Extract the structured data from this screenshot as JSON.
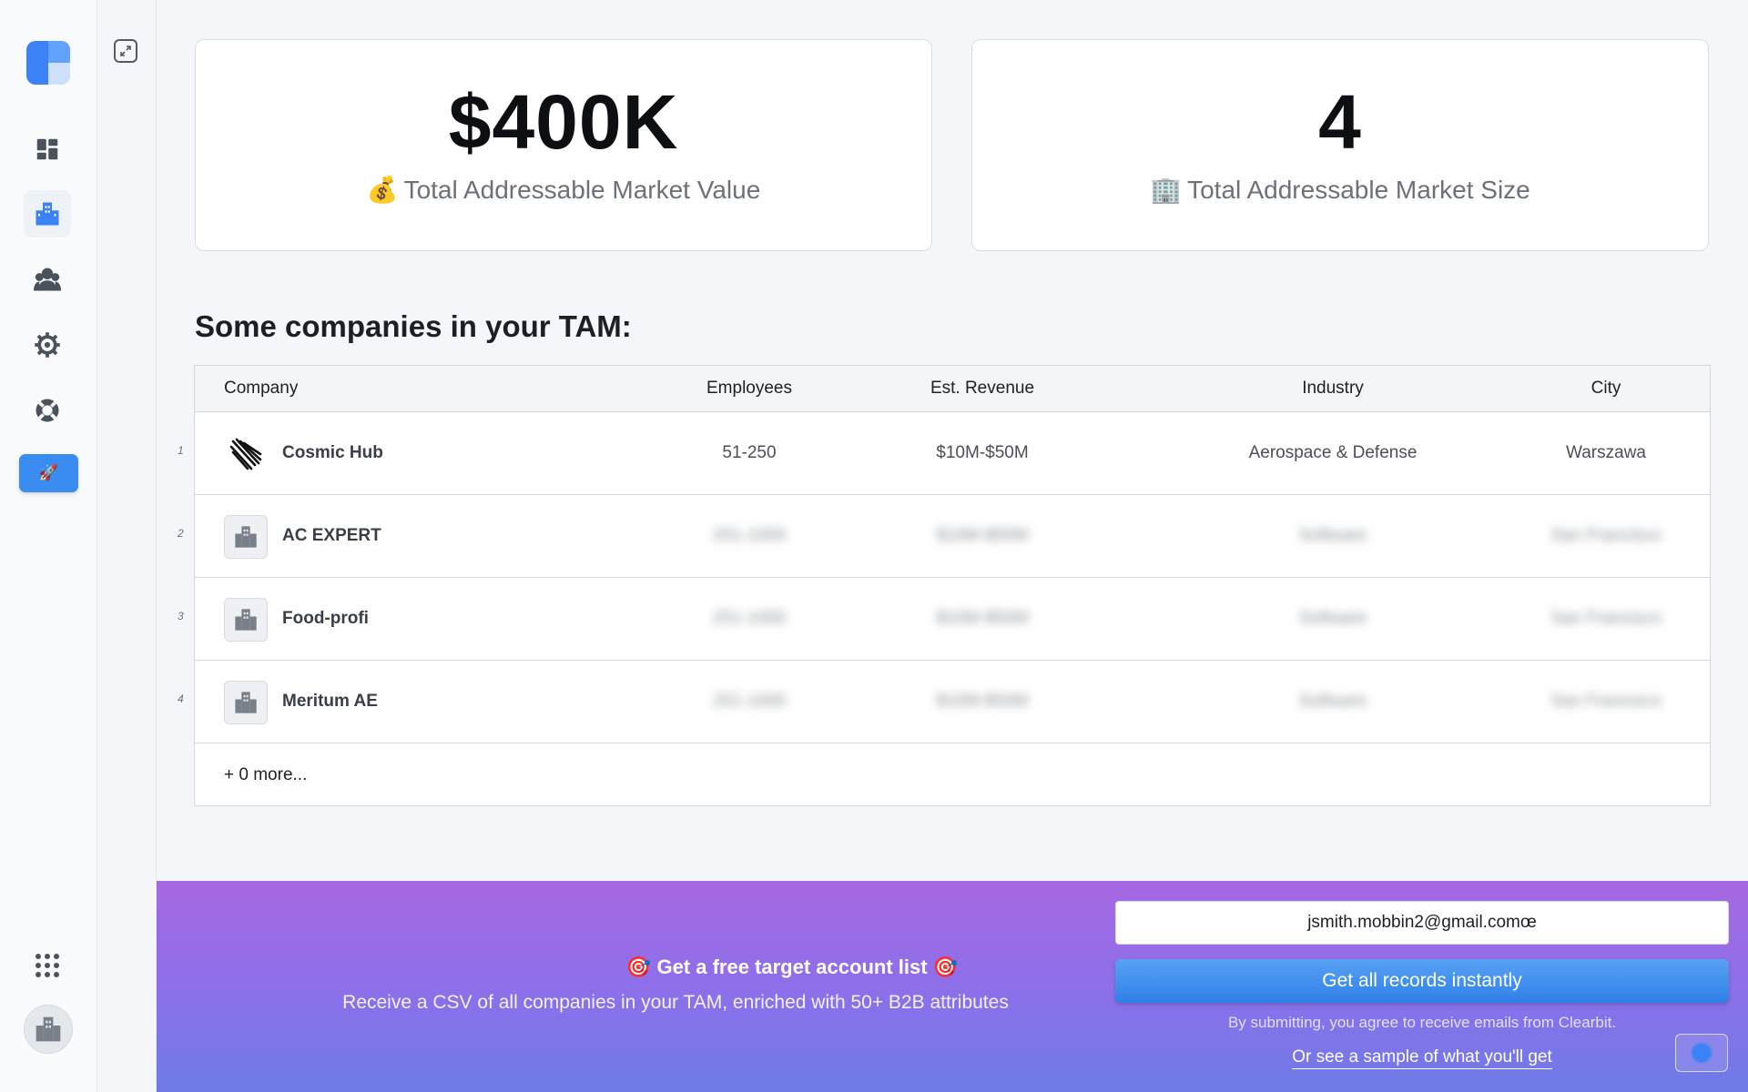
{
  "sidebar": {
    "items": [
      {
        "name": "dashboard",
        "icon": "dashboard-icon"
      },
      {
        "name": "companies",
        "icon": "buildings-icon",
        "active": true
      },
      {
        "name": "people",
        "icon": "people-icon"
      },
      {
        "name": "settings",
        "icon": "gear-icon"
      },
      {
        "name": "support",
        "icon": "lifebuoy-icon"
      },
      {
        "name": "launch",
        "icon": "rocket-icon"
      }
    ]
  },
  "stats": {
    "value": {
      "number": "$400K",
      "emoji": "💰",
      "label": "Total Addressable Market Value"
    },
    "size": {
      "number": "4",
      "emoji": "🏢",
      "label": "Total Addressable Market Size"
    }
  },
  "section_title": "Some companies in your TAM:",
  "table": {
    "headers": {
      "company": "Company",
      "employees": "Employees",
      "revenue": "Est. Revenue",
      "industry": "Industry",
      "city": "City"
    },
    "rows": [
      {
        "num": "1",
        "company": "Cosmic Hub",
        "employees": "51-250",
        "revenue": "$10M-$50M",
        "industry": "Aerospace & Defense",
        "city": "Warszawa"
      },
      {
        "num": "2",
        "company": "AC EXPERT",
        "employees": "251-1000",
        "revenue": "$10M-$50M",
        "industry": "Software",
        "city": "San Francisco"
      },
      {
        "num": "3",
        "company": "Food-profi",
        "employees": "251-1000",
        "revenue": "$10M-$50M",
        "industry": "Software",
        "city": "San Francisco"
      },
      {
        "num": "4",
        "company": "Meritum AE",
        "employees": "251-1000",
        "revenue": "$10M-$50M",
        "industry": "Software",
        "city": "San Francisco"
      }
    ],
    "more": "+ 0 more..."
  },
  "promo": {
    "headline": "Get a free target account list",
    "emoji": "🎯",
    "description": "Receive a CSV of all companies in your TAM, enriched with 50+ B2B attributes",
    "email_value": "jsmith.mobbin2@gmail.comœ",
    "cta": "Get all records instantly",
    "disclaimer": "By submitting, you agree to receive emails from Clearbit.",
    "sample_link": "Or see a sample of what you'll get"
  },
  "colors": {
    "accent": "#3b82f6",
    "promo_start": "#a768e2",
    "promo_end": "#6e7be8"
  }
}
